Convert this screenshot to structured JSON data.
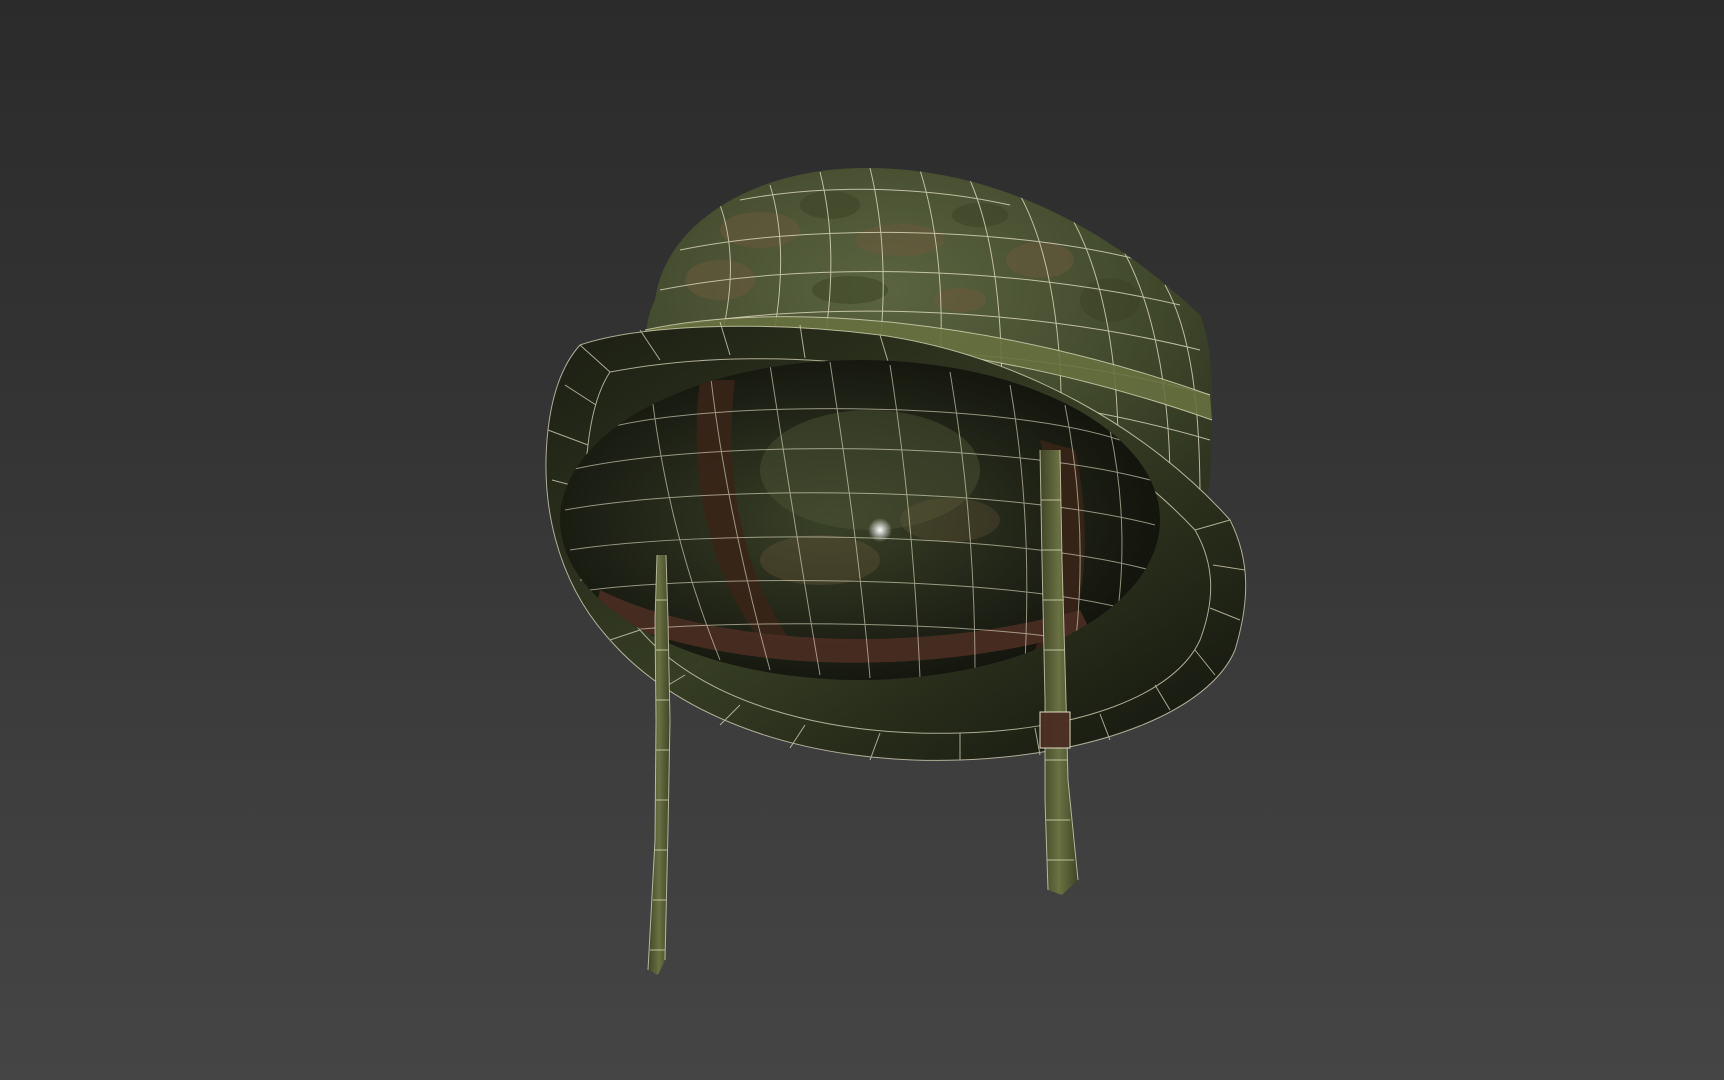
{
  "viewport": {
    "background_top": "#2b2b2b",
    "background_bottom": "#454545",
    "display_mode": "shaded-wireframe"
  },
  "model": {
    "object": "helmet",
    "shell_color": "#4a5233",
    "camo_color": "#6b5a3c",
    "inner_color": "#1a1c12",
    "liner_color": "#3a2418",
    "strap_color": "#5b6338",
    "buckle_color": "#4a2e22",
    "wire_color": "#e8e4c8"
  }
}
